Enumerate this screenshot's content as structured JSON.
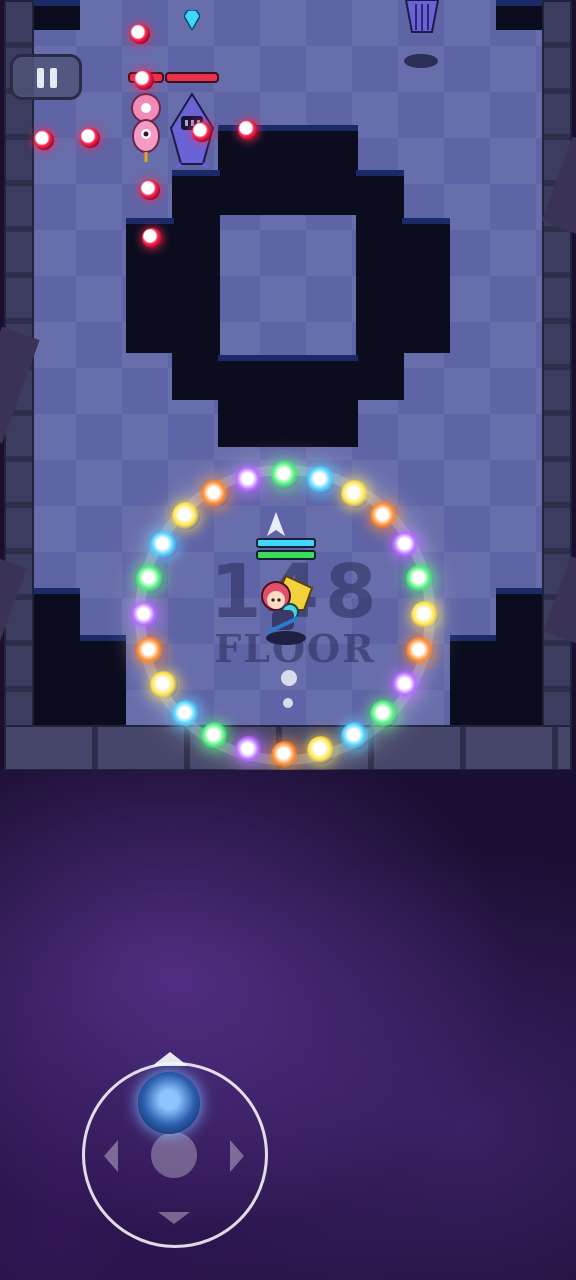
{
  "hud": {
    "pause_icon": "pause-icon"
  },
  "floor": {
    "number": "148",
    "label": "FLOOR"
  },
  "player": {
    "shield_bar_color": "#3fd6ff",
    "health_bar_color": "#3cdc5a"
  },
  "enemy": {
    "health_bar_color": "#e8324a"
  },
  "controls": {
    "joystick": "virtual-joystick",
    "icons": [
      "pause-icon",
      "arrow-left-icon",
      "arrow-right-icon",
      "arrow-down-icon",
      "arrow-up-icon"
    ]
  },
  "colors": {
    "floor_tile": "#5f64a6",
    "pit": "#0b0d1f",
    "accent_line": "#f0a030",
    "enemy_bullet": "#ff2a55",
    "background": "#1a0f2e"
  }
}
